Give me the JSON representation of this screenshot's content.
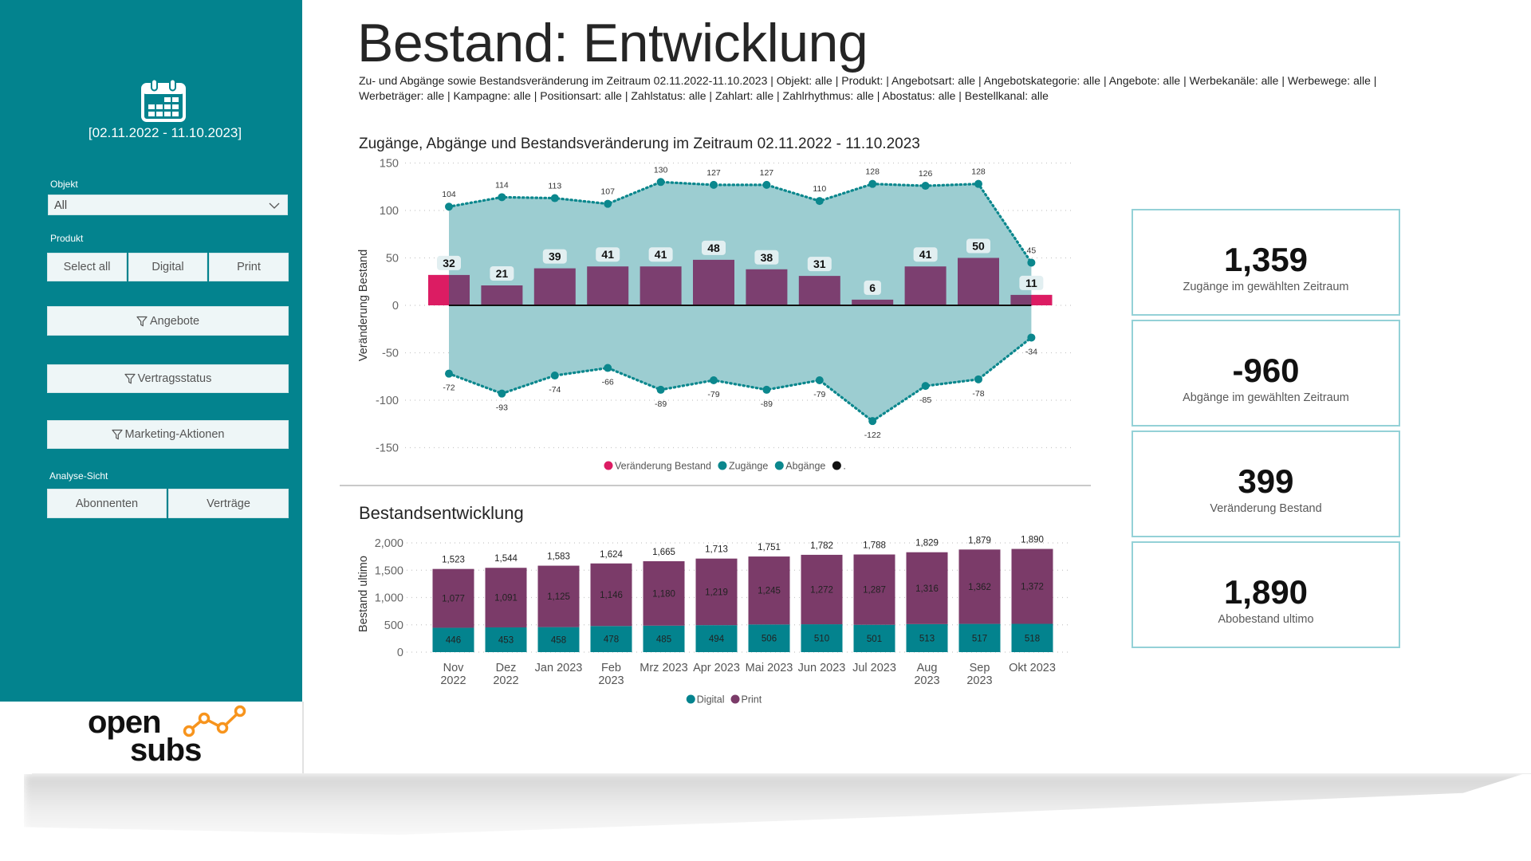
{
  "sidebar": {
    "calendar_icon": "calendar-icon",
    "date_range": "[02.11.2022 - 11.10.2023]",
    "objekt_label": "Objekt",
    "objekt_value": "All",
    "produkt_label": "Produkt",
    "produkt_buttons": [
      "Select all",
      "Digital",
      "Print"
    ],
    "filter_buttons": [
      "Angebote",
      "Vertragsstatus",
      "Marketing-Aktionen"
    ],
    "analyse_label": "Analyse-Sicht",
    "analyse_buttons": [
      "Abonnenten",
      "Verträge"
    ],
    "logo": {
      "line1": "open",
      "line2": "subs"
    }
  },
  "header": {
    "title": "Bestand: Entwicklung",
    "filter_line_1": "Zu- und Abgänge sowie Bestandsveränderung im Zeitraum 02.11.2022-11.10.2023 | Objekt: alle | Produkt: | Angebotsart: alle | Angebotskategorie: alle | Angebote: alle | Werbekanäle: alle | Werbewege: alle |",
    "filter_line_2": "Werbeträger: alle | Kampagne: alle | Positionsart: alle | Zahlstatus: alle | Zahlart: alle | Zahlrhythmus: alle | Abostatus: alle | Bestellkanal: alle"
  },
  "kpis": [
    {
      "value": "1,359",
      "label": "Zugänge im gewählten Zeitraum"
    },
    {
      "value": "-960",
      "label": "Abgänge im gewählten Zeitraum"
    },
    {
      "value": "399",
      "label": "Veränderung Bestand"
    },
    {
      "value": "1,890",
      "label": "Abobestand ultimo"
    }
  ],
  "colors": {
    "sidebar": "#03838e",
    "area": "#9ccdd1",
    "line": "#0b878d",
    "net_bar": "#7c3f70",
    "pink": "#dc1c63",
    "label_box": "#e2eff1",
    "digital": "#03838e",
    "print": "#7b3b69",
    "logo_accent": "#f7941d"
  },
  "chart_data": [
    {
      "type": "bar+line+area",
      "title": "Zugänge, Abgänge und Bestandsveränderung im Zeitraum 02.11.2022 - 11.10.2023",
      "xlabel": "",
      "ylabel": "Veränderung Bestand",
      "ylim": [
        -150,
        150
      ],
      "yticks": [
        150,
        100,
        50,
        0,
        -50,
        -100,
        -150
      ],
      "grid": true,
      "legend_position": "bottom",
      "series": [
        {
          "name": "Veränderung Bestand",
          "values": [
            32,
            21,
            39,
            41,
            41,
            48,
            38,
            31,
            6,
            41,
            50,
            11
          ]
        },
        {
          "name": "Zugänge",
          "values": [
            104,
            114,
            113,
            107,
            130,
            127,
            127,
            110,
            128,
            126,
            128,
            45
          ]
        },
        {
          "name": "Abgänge",
          "values": [
            -72,
            -93,
            -74,
            -66,
            -89,
            -79,
            -89,
            -79,
            -122,
            -85,
            -78,
            -34
          ]
        }
      ],
      "legend": [
        {
          "label": "Veränderung Bestand",
          "color": "#dc1c63"
        },
        {
          "label": "Zugänge",
          "color": "#0b878d"
        },
        {
          "label": "Abgänge",
          "color": "#0b878d"
        },
        {
          "label": ".",
          "color": "#111111"
        }
      ]
    },
    {
      "type": "bar",
      "stacked": true,
      "title": "Bestandsentwicklung",
      "xlabel": "",
      "ylabel": "Bestand ultimo",
      "ylim": [
        0,
        2000
      ],
      "yticks": [
        0,
        500,
        1000,
        1500,
        2000
      ],
      "ytick_labels": [
        "0",
        "500",
        "1,000",
        "1,500",
        "2,000"
      ],
      "grid": true,
      "legend_position": "bottom",
      "categories": [
        "Nov 2022",
        "Dez 2022",
        "Jan 2023",
        "Feb 2023",
        "Mrz 2023",
        "Apr 2023",
        "Mai 2023",
        "Jun 2023",
        "Jul 2023",
        "Aug 2023",
        "Sep 2023",
        "Okt 2023"
      ],
      "x_tick_lines": [
        [
          "Nov",
          "2022"
        ],
        [
          "Dez",
          "2022"
        ],
        [
          "Jan 2023"
        ],
        [
          "Feb",
          "2023"
        ],
        [
          "Mrz 2023"
        ],
        [
          "Apr 2023"
        ],
        [
          "Mai 2023"
        ],
        [
          "Jun 2023"
        ],
        [
          "Jul 2023"
        ],
        [
          "Aug",
          "2023"
        ],
        [
          "Sep",
          "2023"
        ],
        [
          "Okt 2023"
        ]
      ],
      "series": [
        {
          "name": "Digital",
          "values": [
            446,
            453,
            458,
            478,
            485,
            494,
            506,
            510,
            501,
            513,
            517,
            518
          ]
        },
        {
          "name": "Print",
          "values": [
            1077,
            1091,
            1125,
            1146,
            1180,
            1219,
            1245,
            1272,
            1287,
            1316,
            1362,
            1372
          ]
        }
      ],
      "totals": [
        1523,
        1544,
        1583,
        1624,
        1665,
        1713,
        1751,
        1782,
        1788,
        1829,
        1879,
        1890
      ],
      "digital_labels": [
        "446",
        "453",
        "458",
        "478",
        "485",
        "494",
        "506",
        "510",
        "501",
        "513",
        "517",
        "518"
      ],
      "print_labels": [
        "1,077",
        "1,091",
        "1,125",
        "1,146",
        "1,180",
        "1,219",
        "1,245",
        "1,272",
        "1,287",
        "1,316",
        "1,362",
        "1,372"
      ],
      "total_labels": [
        "1,523",
        "1,544",
        "1,583",
        "1,624",
        "1,665",
        "1,713",
        "1,751",
        "1,782",
        "1,788",
        "1,829",
        "1,879",
        "1,890"
      ],
      "legend": [
        {
          "label": "Digital",
          "color": "#03838e"
        },
        {
          "label": "Print",
          "color": "#7b3b69"
        }
      ]
    }
  ]
}
